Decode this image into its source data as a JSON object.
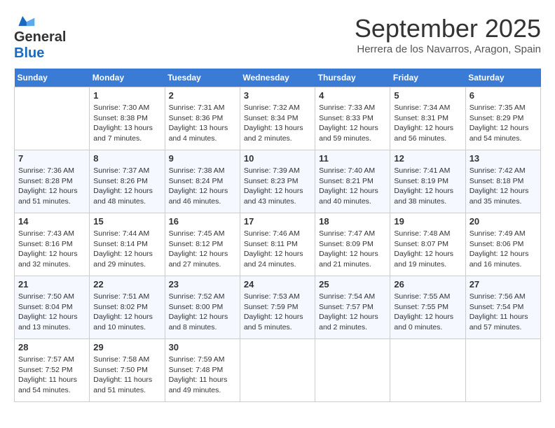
{
  "header": {
    "logo_line1": "General",
    "logo_line2": "Blue",
    "month": "September 2025",
    "location": "Herrera de los Navarros, Aragon, Spain"
  },
  "days_of_week": [
    "Sunday",
    "Monday",
    "Tuesday",
    "Wednesday",
    "Thursday",
    "Friday",
    "Saturday"
  ],
  "weeks": [
    [
      {
        "day": "",
        "sunrise": "",
        "sunset": "",
        "daylight": ""
      },
      {
        "day": "1",
        "sunrise": "Sunrise: 7:30 AM",
        "sunset": "Sunset: 8:38 PM",
        "daylight": "Daylight: 13 hours and 7 minutes."
      },
      {
        "day": "2",
        "sunrise": "Sunrise: 7:31 AM",
        "sunset": "Sunset: 8:36 PM",
        "daylight": "Daylight: 13 hours and 4 minutes."
      },
      {
        "day": "3",
        "sunrise": "Sunrise: 7:32 AM",
        "sunset": "Sunset: 8:34 PM",
        "daylight": "Daylight: 13 hours and 2 minutes."
      },
      {
        "day": "4",
        "sunrise": "Sunrise: 7:33 AM",
        "sunset": "Sunset: 8:33 PM",
        "daylight": "Daylight: 12 hours and 59 minutes."
      },
      {
        "day": "5",
        "sunrise": "Sunrise: 7:34 AM",
        "sunset": "Sunset: 8:31 PM",
        "daylight": "Daylight: 12 hours and 56 minutes."
      },
      {
        "day": "6",
        "sunrise": "Sunrise: 7:35 AM",
        "sunset": "Sunset: 8:29 PM",
        "daylight": "Daylight: 12 hours and 54 minutes."
      }
    ],
    [
      {
        "day": "7",
        "sunrise": "Sunrise: 7:36 AM",
        "sunset": "Sunset: 8:28 PM",
        "daylight": "Daylight: 12 hours and 51 minutes."
      },
      {
        "day": "8",
        "sunrise": "Sunrise: 7:37 AM",
        "sunset": "Sunset: 8:26 PM",
        "daylight": "Daylight: 12 hours and 48 minutes."
      },
      {
        "day": "9",
        "sunrise": "Sunrise: 7:38 AM",
        "sunset": "Sunset: 8:24 PM",
        "daylight": "Daylight: 12 hours and 46 minutes."
      },
      {
        "day": "10",
        "sunrise": "Sunrise: 7:39 AM",
        "sunset": "Sunset: 8:23 PM",
        "daylight": "Daylight: 12 hours and 43 minutes."
      },
      {
        "day": "11",
        "sunrise": "Sunrise: 7:40 AM",
        "sunset": "Sunset: 8:21 PM",
        "daylight": "Daylight: 12 hours and 40 minutes."
      },
      {
        "day": "12",
        "sunrise": "Sunrise: 7:41 AM",
        "sunset": "Sunset: 8:19 PM",
        "daylight": "Daylight: 12 hours and 38 minutes."
      },
      {
        "day": "13",
        "sunrise": "Sunrise: 7:42 AM",
        "sunset": "Sunset: 8:18 PM",
        "daylight": "Daylight: 12 hours and 35 minutes."
      }
    ],
    [
      {
        "day": "14",
        "sunrise": "Sunrise: 7:43 AM",
        "sunset": "Sunset: 8:16 PM",
        "daylight": "Daylight: 12 hours and 32 minutes."
      },
      {
        "day": "15",
        "sunrise": "Sunrise: 7:44 AM",
        "sunset": "Sunset: 8:14 PM",
        "daylight": "Daylight: 12 hours and 29 minutes."
      },
      {
        "day": "16",
        "sunrise": "Sunrise: 7:45 AM",
        "sunset": "Sunset: 8:12 PM",
        "daylight": "Daylight: 12 hours and 27 minutes."
      },
      {
        "day": "17",
        "sunrise": "Sunrise: 7:46 AM",
        "sunset": "Sunset: 8:11 PM",
        "daylight": "Daylight: 12 hours and 24 minutes."
      },
      {
        "day": "18",
        "sunrise": "Sunrise: 7:47 AM",
        "sunset": "Sunset: 8:09 PM",
        "daylight": "Daylight: 12 hours and 21 minutes."
      },
      {
        "day": "19",
        "sunrise": "Sunrise: 7:48 AM",
        "sunset": "Sunset: 8:07 PM",
        "daylight": "Daylight: 12 hours and 19 minutes."
      },
      {
        "day": "20",
        "sunrise": "Sunrise: 7:49 AM",
        "sunset": "Sunset: 8:06 PM",
        "daylight": "Daylight: 12 hours and 16 minutes."
      }
    ],
    [
      {
        "day": "21",
        "sunrise": "Sunrise: 7:50 AM",
        "sunset": "Sunset: 8:04 PM",
        "daylight": "Daylight: 12 hours and 13 minutes."
      },
      {
        "day": "22",
        "sunrise": "Sunrise: 7:51 AM",
        "sunset": "Sunset: 8:02 PM",
        "daylight": "Daylight: 12 hours and 10 minutes."
      },
      {
        "day": "23",
        "sunrise": "Sunrise: 7:52 AM",
        "sunset": "Sunset: 8:00 PM",
        "daylight": "Daylight: 12 hours and 8 minutes."
      },
      {
        "day": "24",
        "sunrise": "Sunrise: 7:53 AM",
        "sunset": "Sunset: 7:59 PM",
        "daylight": "Daylight: 12 hours and 5 minutes."
      },
      {
        "day": "25",
        "sunrise": "Sunrise: 7:54 AM",
        "sunset": "Sunset: 7:57 PM",
        "daylight": "Daylight: 12 hours and 2 minutes."
      },
      {
        "day": "26",
        "sunrise": "Sunrise: 7:55 AM",
        "sunset": "Sunset: 7:55 PM",
        "daylight": "Daylight: 12 hours and 0 minutes."
      },
      {
        "day": "27",
        "sunrise": "Sunrise: 7:56 AM",
        "sunset": "Sunset: 7:54 PM",
        "daylight": "Daylight: 11 hours and 57 minutes."
      }
    ],
    [
      {
        "day": "28",
        "sunrise": "Sunrise: 7:57 AM",
        "sunset": "Sunset: 7:52 PM",
        "daylight": "Daylight: 11 hours and 54 minutes."
      },
      {
        "day": "29",
        "sunrise": "Sunrise: 7:58 AM",
        "sunset": "Sunset: 7:50 PM",
        "daylight": "Daylight: 11 hours and 51 minutes."
      },
      {
        "day": "30",
        "sunrise": "Sunrise: 7:59 AM",
        "sunset": "Sunset: 7:48 PM",
        "daylight": "Daylight: 11 hours and 49 minutes."
      },
      {
        "day": "",
        "sunrise": "",
        "sunset": "",
        "daylight": ""
      },
      {
        "day": "",
        "sunrise": "",
        "sunset": "",
        "daylight": ""
      },
      {
        "day": "",
        "sunrise": "",
        "sunset": "",
        "daylight": ""
      },
      {
        "day": "",
        "sunrise": "",
        "sunset": "",
        "daylight": ""
      }
    ]
  ]
}
